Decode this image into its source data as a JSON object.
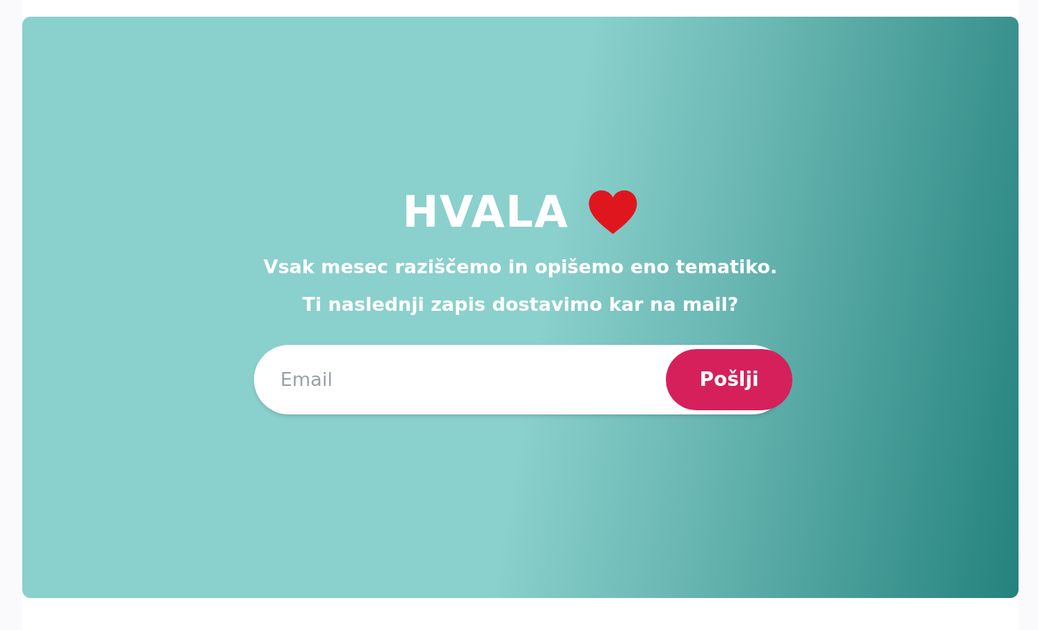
{
  "heading": "HVALA",
  "lines": [
    "Vsak mesec raziščemo in opišemo eno tematiko.",
    "Ti naslednji zapis dostavimo kar na mail?"
  ],
  "form": {
    "email": {
      "placeholder": "Email"
    },
    "submit": "Pošlji"
  }
}
